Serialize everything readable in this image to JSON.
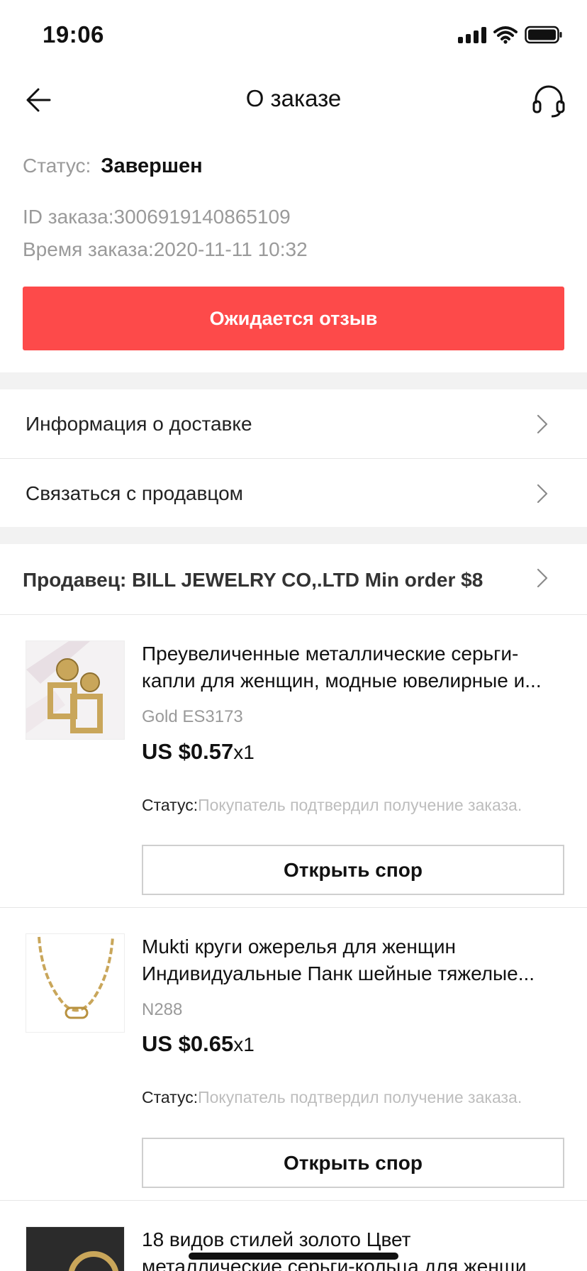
{
  "status_bar": {
    "time": "19:06"
  },
  "nav": {
    "title": "О заказе"
  },
  "order": {
    "status_label": "Статус:",
    "status_value": "Завершен",
    "id_line": "ID заказа:3006919140865109",
    "time_line": "Время заказа:2020-11-11 10:32",
    "review_button": "Ожидается отзыв"
  },
  "links": {
    "delivery": "Информация о доставке",
    "contact": "Связаться с продавцом"
  },
  "seller": {
    "label": "Продавец: BILL JEWELRY CO,.LTD Min order $8"
  },
  "items": [
    {
      "title_line1": "Преувеличенные металлические серьги-",
      "title_line2": "капли для женщин, модные ювелирные и...",
      "sku": "Gold ES3173",
      "price": "US $0.57",
      "qty": "x1",
      "status_label": "Статус:",
      "status_value": "Покупатель подтвердил получение заказа.",
      "button": "Открыть спор"
    },
    {
      "title_line1": "Mukti круги ожерелья для женщин",
      "title_line2": "Индивидуальные Панк шейные тяжелые...",
      "sku": "N288",
      "price": "US $0.65",
      "qty": "x1",
      "status_label": "Статус:",
      "status_value": "Покупатель подтвердил получение заказа.",
      "button": "Открыть спор"
    },
    {
      "title_line1": "18 видов стилей золото Цвет",
      "title_line2": "металлические серьги-кольца для женщи..."
    }
  ],
  "colors": {
    "accent": "#fd4a4a",
    "muted_text": "#9a9a9a",
    "separator": "#f2f2f2"
  }
}
